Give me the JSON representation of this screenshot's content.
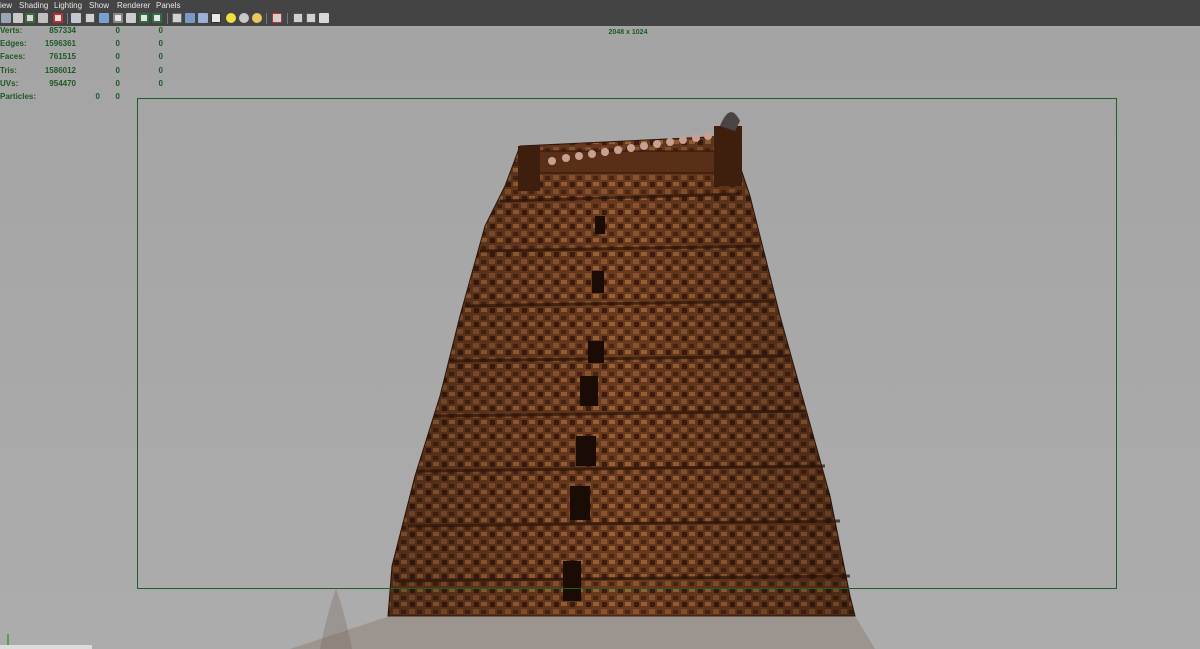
{
  "menu": {
    "items": [
      "iew",
      "Shading",
      "Lighting",
      "Show",
      "Renderer",
      "Panels"
    ]
  },
  "toolbar": {
    "icons": [
      "select-camera-icon",
      "camera-attributes-icon",
      "bookmark-icon",
      "image-plane-icon",
      "grease-pencil-icon",
      "2d-pan-zoom-icon",
      "grid-icon",
      "film-gate-icon",
      "resolution-gate-icon",
      "gate-mask-icon",
      "field-chart-icon",
      "safe-action-icon",
      "safe-title-icon",
      "wireframe-icon",
      "smooth-shade-icon",
      "wireframe-on-shaded-icon",
      "textured-icon",
      "use-all-lights-icon",
      "shadows-icon",
      "screen-space-ao-icon",
      "motion-blur-icon",
      "isolate-select-icon",
      "xray-icon",
      "xray-joints-icon"
    ]
  },
  "hud": {
    "rows": [
      {
        "label": "Verts:",
        "v1": "857334",
        "v2": "0",
        "v3": "0"
      },
      {
        "label": "Edges:",
        "v1": "1596361",
        "v2": "0",
        "v3": "0"
      },
      {
        "label": "Faces:",
        "v1": "761515",
        "v2": "0",
        "v3": "0"
      },
      {
        "label": "Tris:",
        "v1": "1586012",
        "v2": "0",
        "v3": "0"
      },
      {
        "label": "UVs:",
        "v1": "954470",
        "v2": "0",
        "v3": "0"
      },
      {
        "label": "Particles:",
        "v1": "0",
        "v2": "0",
        "v3": ""
      }
    ]
  },
  "viewport": {
    "resolution": "2048 x 1024",
    "gate_color": "#1f5f2a",
    "background": "#a8a8a8"
  },
  "model": {
    "name": "temple-gopuram-model",
    "color": "#6a3a1e"
  }
}
